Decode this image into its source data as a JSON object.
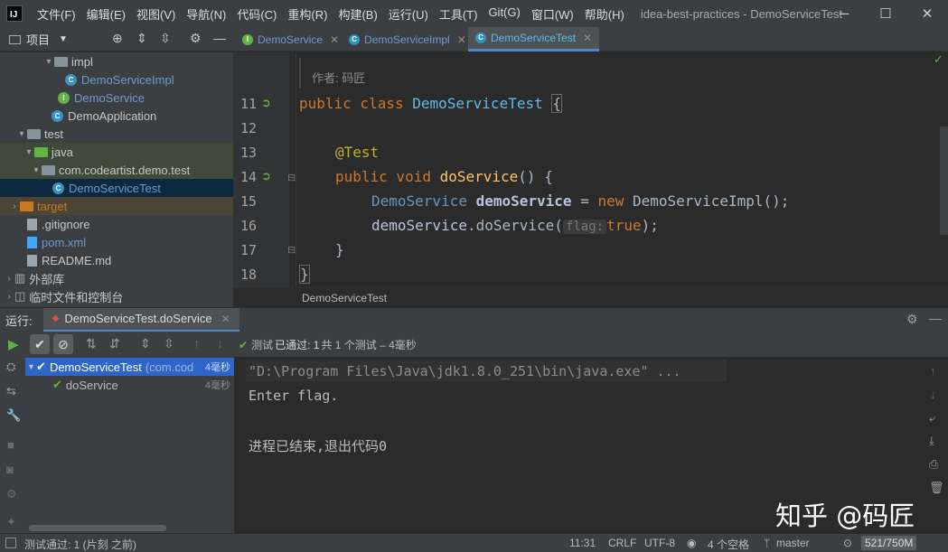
{
  "titlebar": {
    "logo": "IJ",
    "menus": [
      "文件(F)",
      "编辑(E)",
      "视图(V)",
      "导航(N)",
      "代码(C)",
      "重构(R)",
      "构建(B)",
      "运行(U)",
      "工具(T)",
      "Git(G)",
      "窗口(W)",
      "帮助(H)"
    ],
    "title": "idea-best-practices - DemoServiceTest"
  },
  "project_panel": {
    "label": "项目"
  },
  "editor_tabs": [
    "DemoService",
    "DemoServiceImpl",
    "DemoServiceTest"
  ],
  "tree": {
    "impl": "impl",
    "impl_class": "DemoServiceImpl",
    "service": "DemoService",
    "app": "DemoApplication",
    "test": "test",
    "java": "java",
    "package": "com.codeartist.demo.test",
    "test_class": "DemoServiceTest",
    "target": "target",
    "gitignore": ".gitignore",
    "pom": "pom.xml",
    "readme": "README.md",
    "ext_libs": "外部库",
    "scratches": "临时文件和控制台"
  },
  "editor": {
    "author_hint": "作者: 码匠",
    "line_numbers": [
      "11",
      "12",
      "13",
      "14",
      "15",
      "16",
      "17",
      "18"
    ],
    "lines": {
      "l11_kw": "public class ",
      "l11_cls": "DemoServiceTest ",
      "l11_brace": "{",
      "l13": "@Test",
      "l14_kw": "public void ",
      "l14_fn": "doService",
      "l14_rest": "() {",
      "l15_type": "DemoService ",
      "l15_var": "demoService",
      "l15_eq": " = ",
      "l15_new": "new ",
      "l15_impl": "DemoServiceImpl",
      "l15_end": "();",
      "l16_var": "demoService",
      "l16_call": ".doService(",
      "l16_hint": "flag:",
      "l16_val": "true",
      "l16_end": ");",
      "l17": "}",
      "l18": "}"
    },
    "breadcrumb": "DemoServiceTest"
  },
  "run": {
    "label": "运行:",
    "config": "DemoServiceTest.doService",
    "status_prefix": "测试 ",
    "status_passed": "已通过: 1",
    "status_rest": "共 1 个测试 – 4毫秒",
    "tests": [
      {
        "name": "DemoServiceTest",
        "extra": "(com.cod",
        "time": "4毫秒"
      },
      {
        "name": "doService",
        "extra": "",
        "time": "4毫秒"
      }
    ],
    "console": [
      "\"D:\\Program Files\\Java\\jdk1.8.0_251\\bin\\java.exe\" ...",
      "Enter flag.",
      "",
      "进程已结束,退出代码0"
    ]
  },
  "watermark": "知乎 @码匠",
  "statusbar": {
    "left": "测试通过: 1 (片刻 之前)",
    "position": "11:31",
    "line_sep": "CRLF",
    "encoding": "UTF-8",
    "indent": "4 个空格",
    "branch": "master",
    "memory": "521/750M"
  },
  "colors": {
    "accent": "#4a88c7",
    "pass": "#62b543",
    "class_icon": "#3592c4"
  }
}
